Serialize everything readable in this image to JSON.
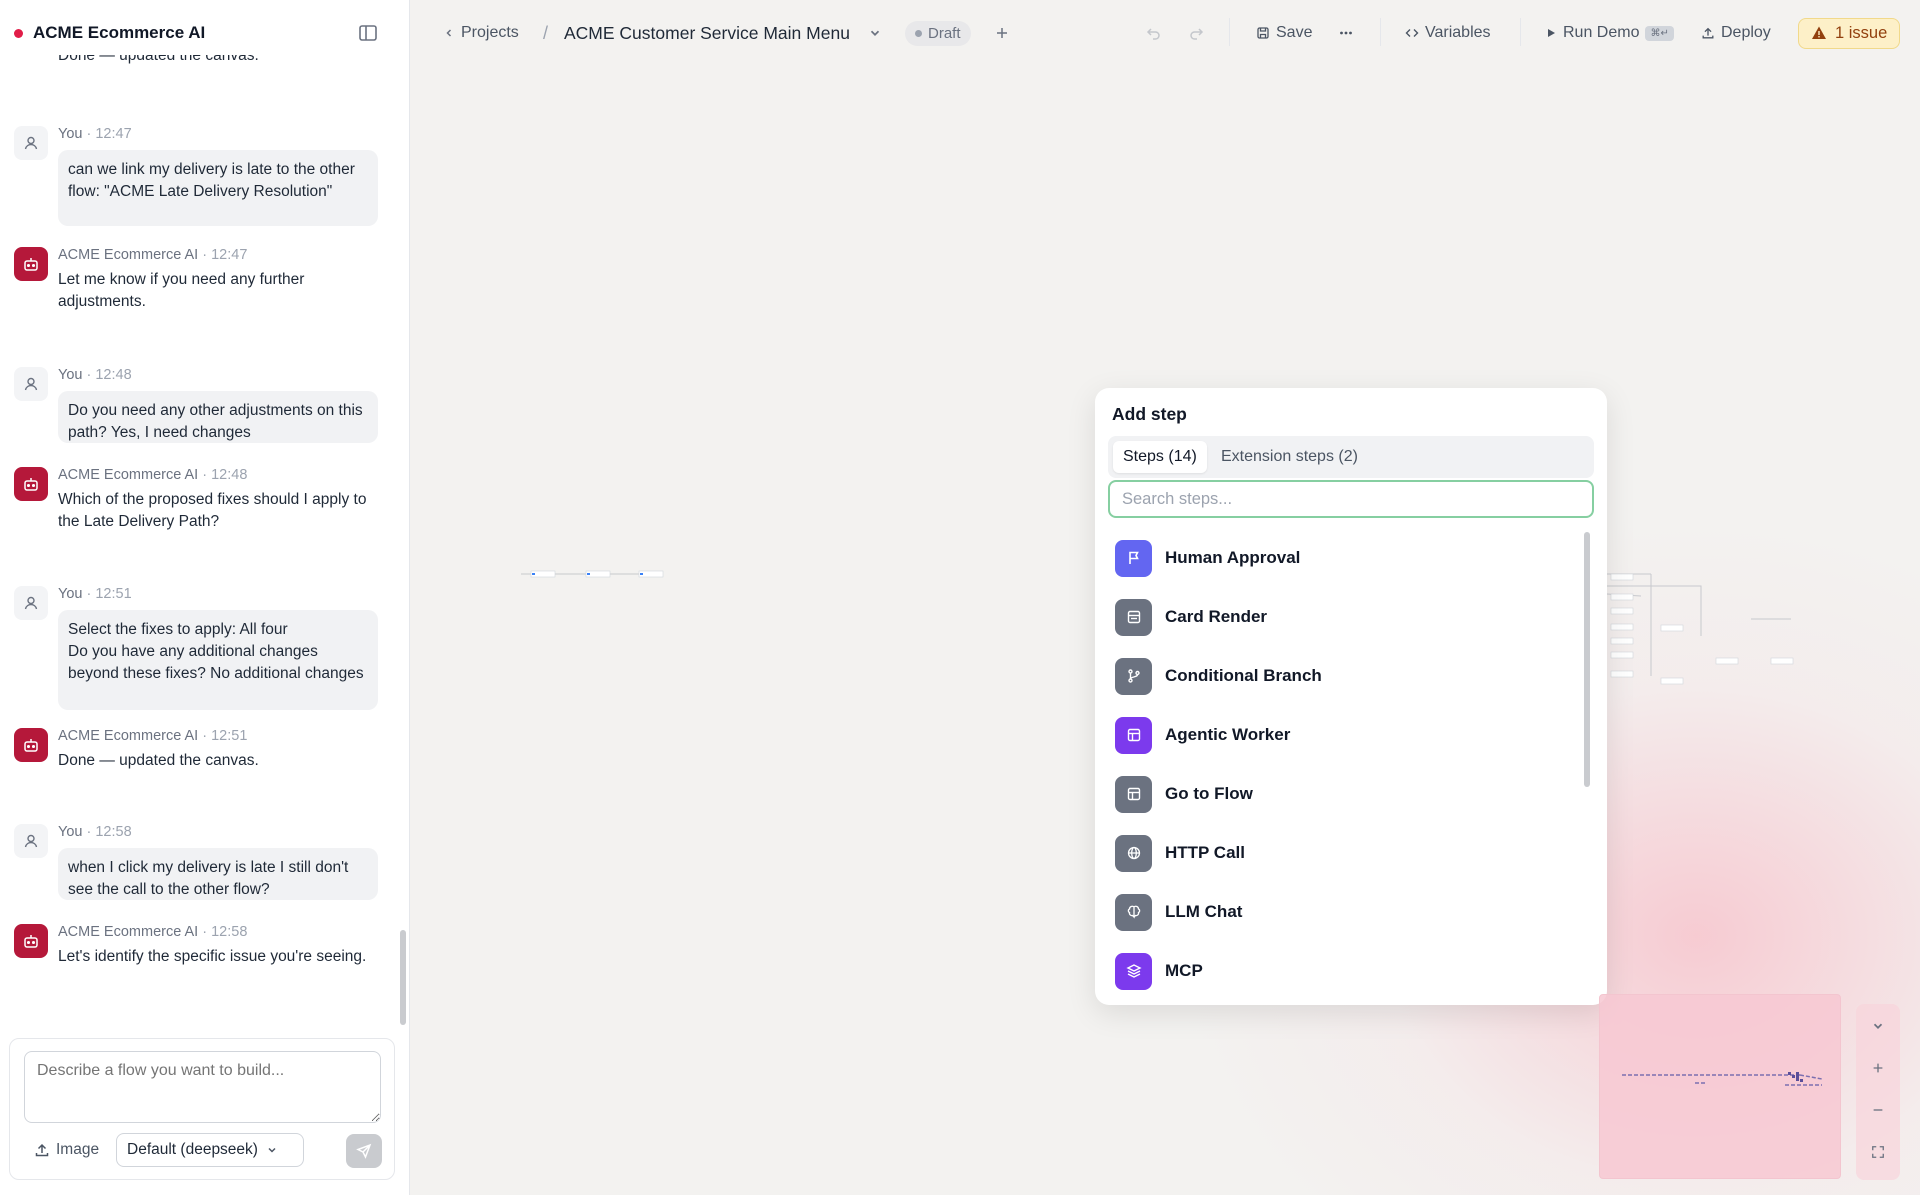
{
  "sidebar": {
    "app_name": "ACME Ecommerce AI",
    "top_partial": "Done — updated the canvas.",
    "messages": [
      {
        "author": "You",
        "time": "12:47",
        "text": "can we link my delivery is late to the other flow: \"ACME Late Delivery Resolution\""
      },
      {
        "author": "ACME Ecommerce AI",
        "time": "12:47",
        "text": "Let me know if you need any further adjustments."
      },
      {
        "author": "You",
        "time": "12:48",
        "text": "Do you need any other adjustments on this path? Yes, I need changes"
      },
      {
        "author": "ACME Ecommerce AI",
        "time": "12:48",
        "text": "Which of the proposed fixes should I apply to the Late Delivery Path?"
      },
      {
        "author": "You",
        "time": "12:51",
        "text": "Select the fixes to apply: All four\nDo you have any additional changes beyond these fixes? No additional changes"
      },
      {
        "author": "ACME Ecommerce AI",
        "time": "12:51",
        "text": "Done — updated the canvas."
      },
      {
        "author": "You",
        "time": "12:58",
        "text": "when I click my delivery is late I still don't see the call to the other flow?"
      },
      {
        "author": "ACME Ecommerce AI",
        "time": "12:58",
        "text": "Let's identify the specific issue you're seeing."
      }
    ],
    "composer": {
      "placeholder": "Describe a flow you want to build...",
      "image_label": "Image",
      "model_label": "Default (deepseek)"
    }
  },
  "topbar": {
    "back_label": "Projects",
    "separator": "/",
    "flow_title": "ACME Customer Service Main Menu",
    "draft_label": "Draft",
    "save_label": "Save",
    "variables_label": "Variables",
    "run_demo_label": "Run Demo",
    "run_demo_shortcut": "⌘↵",
    "deploy_label": "Deploy",
    "issue_label": "1 issue"
  },
  "add_step": {
    "title": "Add step",
    "tabs": [
      {
        "label": "Steps (14)",
        "active": true
      },
      {
        "label": "Extension steps (2)",
        "active": false
      }
    ],
    "search_placeholder": "Search steps...",
    "steps": [
      {
        "label": "Human Approval",
        "icon": "flag-icon",
        "color": "#6366f1"
      },
      {
        "label": "Card Render",
        "icon": "card-icon",
        "color": "#6b7280"
      },
      {
        "label": "Conditional Branch",
        "icon": "branch-icon",
        "color": "#6b7280"
      },
      {
        "label": "Agentic Worker",
        "icon": "layout-icon",
        "color": "#7c3aed"
      },
      {
        "label": "Go to Flow",
        "icon": "layout-icon",
        "color": "#6b7280"
      },
      {
        "label": "HTTP Call",
        "icon": "globe-icon",
        "color": "#6b7280"
      },
      {
        "label": "LLM Chat",
        "icon": "brain-icon",
        "color": "#6b7280"
      },
      {
        "label": "MCP",
        "icon": "layers-icon",
        "color": "#7c3aed"
      }
    ]
  },
  "colors": {
    "accent": "#b5183a",
    "issue_bg": "#fdf0c8",
    "search_focus": "#86cfa1"
  }
}
